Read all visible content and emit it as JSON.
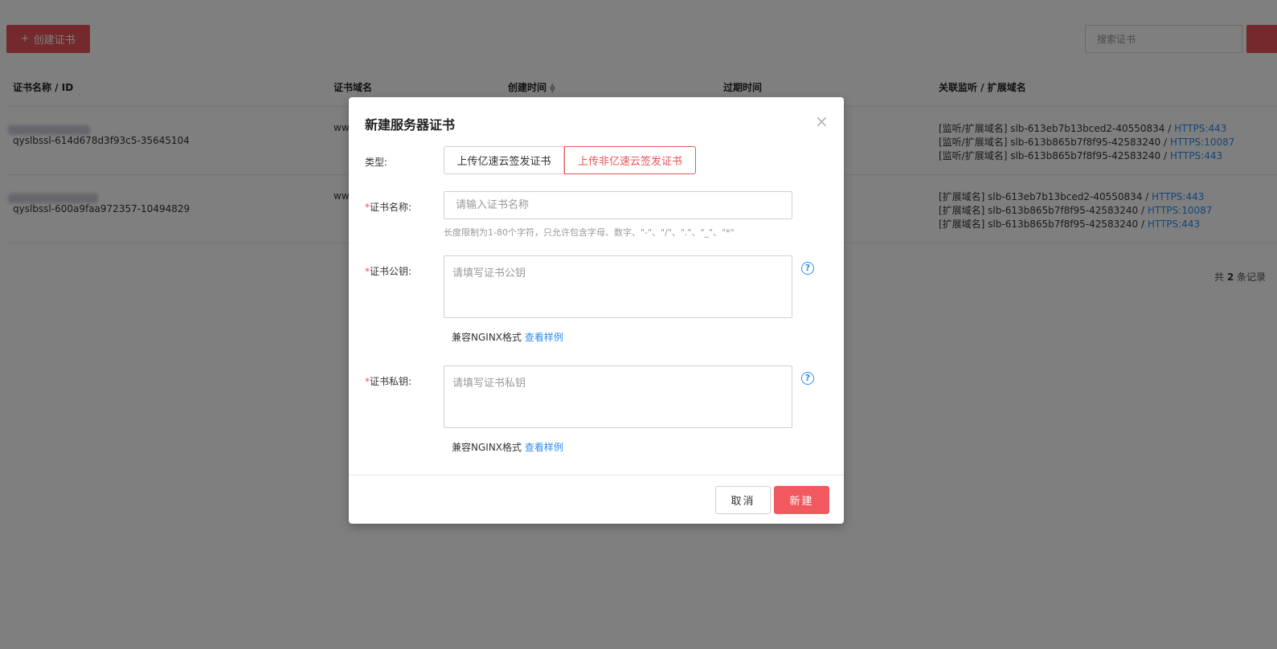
{
  "toolbar": {
    "create_label": "创建证书",
    "search_placeholder": "搜索证书"
  },
  "table": {
    "columns": [
      "证书名称 / ID",
      "证书域名",
      "创建时间",
      "过期时间",
      "关联监听 / 扩展域名"
    ],
    "rows": [
      {
        "id": "qyslbssl-614d678d3f93c5-35645104",
        "domain": "ww",
        "links": [
          {
            "prefix": "[监听/扩展域名] slb-613eb7b13bced2-40550834 / ",
            "link": "HTTPS:443"
          },
          {
            "prefix": "[监听/扩展域名] slb-613b865b7f8f95-42583240 / ",
            "link": "HTTPS:10087"
          },
          {
            "prefix": "[监听/扩展域名] slb-613b865b7f8f95-42583240 / ",
            "link": "HTTPS:443"
          }
        ]
      },
      {
        "id": "qyslbssl-600a9faa972357-10494829",
        "domain": "ww",
        "links": [
          {
            "prefix": "[扩展域名] slb-613eb7b13bced2-40550834 / ",
            "link": "HTTPS:443"
          },
          {
            "prefix": "[扩展域名] slb-613b865b7f8f95-42583240 / ",
            "link": "HTTPS:10087"
          },
          {
            "prefix": "[扩展域名] slb-613b865b7f8f95-42583240 / ",
            "link": "HTTPS:443"
          }
        ]
      }
    ],
    "total_prefix": "共",
    "total_count": "2",
    "total_suffix": "条记录"
  },
  "modal": {
    "title": "新建服务器证书",
    "close": "×",
    "type_label": "类型:",
    "type_options": [
      "上传亿速云签发证书",
      "上传非亿速云签发证书"
    ],
    "selected_type": "上传非亿速云签发证书",
    "required_mark": "*",
    "name_label": "证书名称:",
    "name_placeholder": "请输入证书名称",
    "name_hint": "长度限制为1-80个字符，只允许包含字母、数字、\"-\"、\"/\"、\".\"、\"_\"、\"*\"",
    "public_key_label": "证书公钥:",
    "public_key_placeholder": "请填写证书公钥",
    "private_key_label": "证书私钥:",
    "private_key_placeholder": "请填写证书私钥",
    "compat_text": "兼容NGINX格式 ",
    "example_link": "查看样例",
    "help": "?",
    "cancel": "取消",
    "confirm": "新建"
  },
  "colors": {
    "brand_red": "#e85458",
    "link_blue": "#2d8cf0"
  }
}
